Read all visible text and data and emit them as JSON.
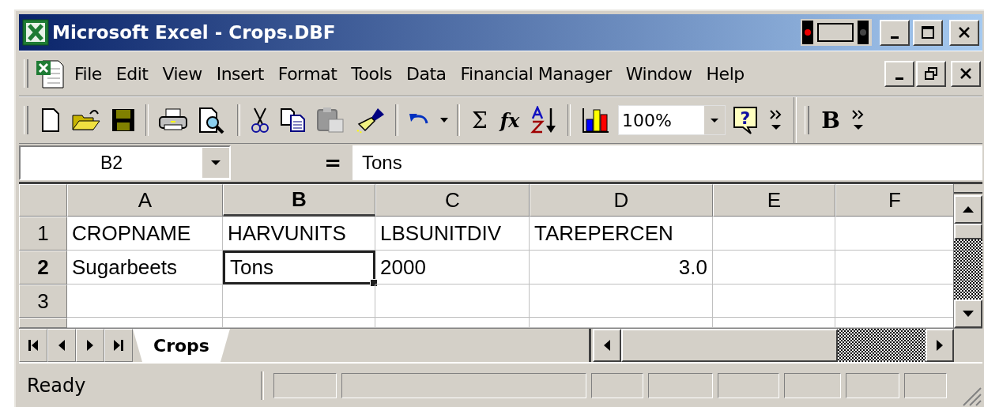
{
  "window": {
    "title": "Microsoft Excel - Crops.DBF"
  },
  "menu": [
    {
      "label": "File"
    },
    {
      "label": "Edit"
    },
    {
      "label": "View"
    },
    {
      "label": "Insert"
    },
    {
      "label": "Format"
    },
    {
      "label": "Tools"
    },
    {
      "label": "Data"
    },
    {
      "label": "Financial Manager"
    },
    {
      "label": "Window"
    },
    {
      "label": "Help"
    }
  ],
  "toolbar": {
    "help_glyph": "?",
    "paste_disabled": true,
    "sum_glyph": "Σ",
    "function_glyph": "fx",
    "zoom": "100%",
    "bold_glyph": "B"
  },
  "formula_bar": {
    "name_box": "B2",
    "equals": "=",
    "value": "Tons"
  },
  "columns": [
    {
      "label": "A",
      "selected": false
    },
    {
      "label": "B",
      "selected": true
    },
    {
      "label": "C",
      "selected": false
    },
    {
      "label": "D",
      "selected": false
    },
    {
      "label": "E",
      "selected": false
    },
    {
      "label": "F",
      "selected": false
    }
  ],
  "rows": [
    {
      "header": "1",
      "selected": false,
      "cells": [
        {
          "text": "CROPNAME",
          "kind": "text",
          "selected": false
        },
        {
          "text": "HARVUNITS",
          "kind": "text",
          "selected": false
        },
        {
          "text": "LBSUNITDIV",
          "kind": "text",
          "selected": false
        },
        {
          "text": "TAREPERCEN",
          "kind": "text",
          "selected": false
        },
        null,
        null
      ]
    },
    {
      "header": "2",
      "selected": true,
      "cells": [
        {
          "text": "Sugarbeets",
          "kind": "text",
          "selected": false
        },
        {
          "text": "Tons",
          "kind": "text",
          "selected": true
        },
        {
          "text": "2000",
          "kind": "text",
          "selected": false
        },
        {
          "text": "3.0",
          "kind": "number",
          "selected": false
        },
        null,
        null
      ]
    },
    {
      "header": "3",
      "selected": false,
      "cells": [
        null,
        null,
        null,
        null,
        null,
        null
      ]
    }
  ],
  "sheet_tabs": [
    {
      "label": "Crops",
      "selected": true
    }
  ],
  "status_bar": {
    "text": "Ready"
  }
}
